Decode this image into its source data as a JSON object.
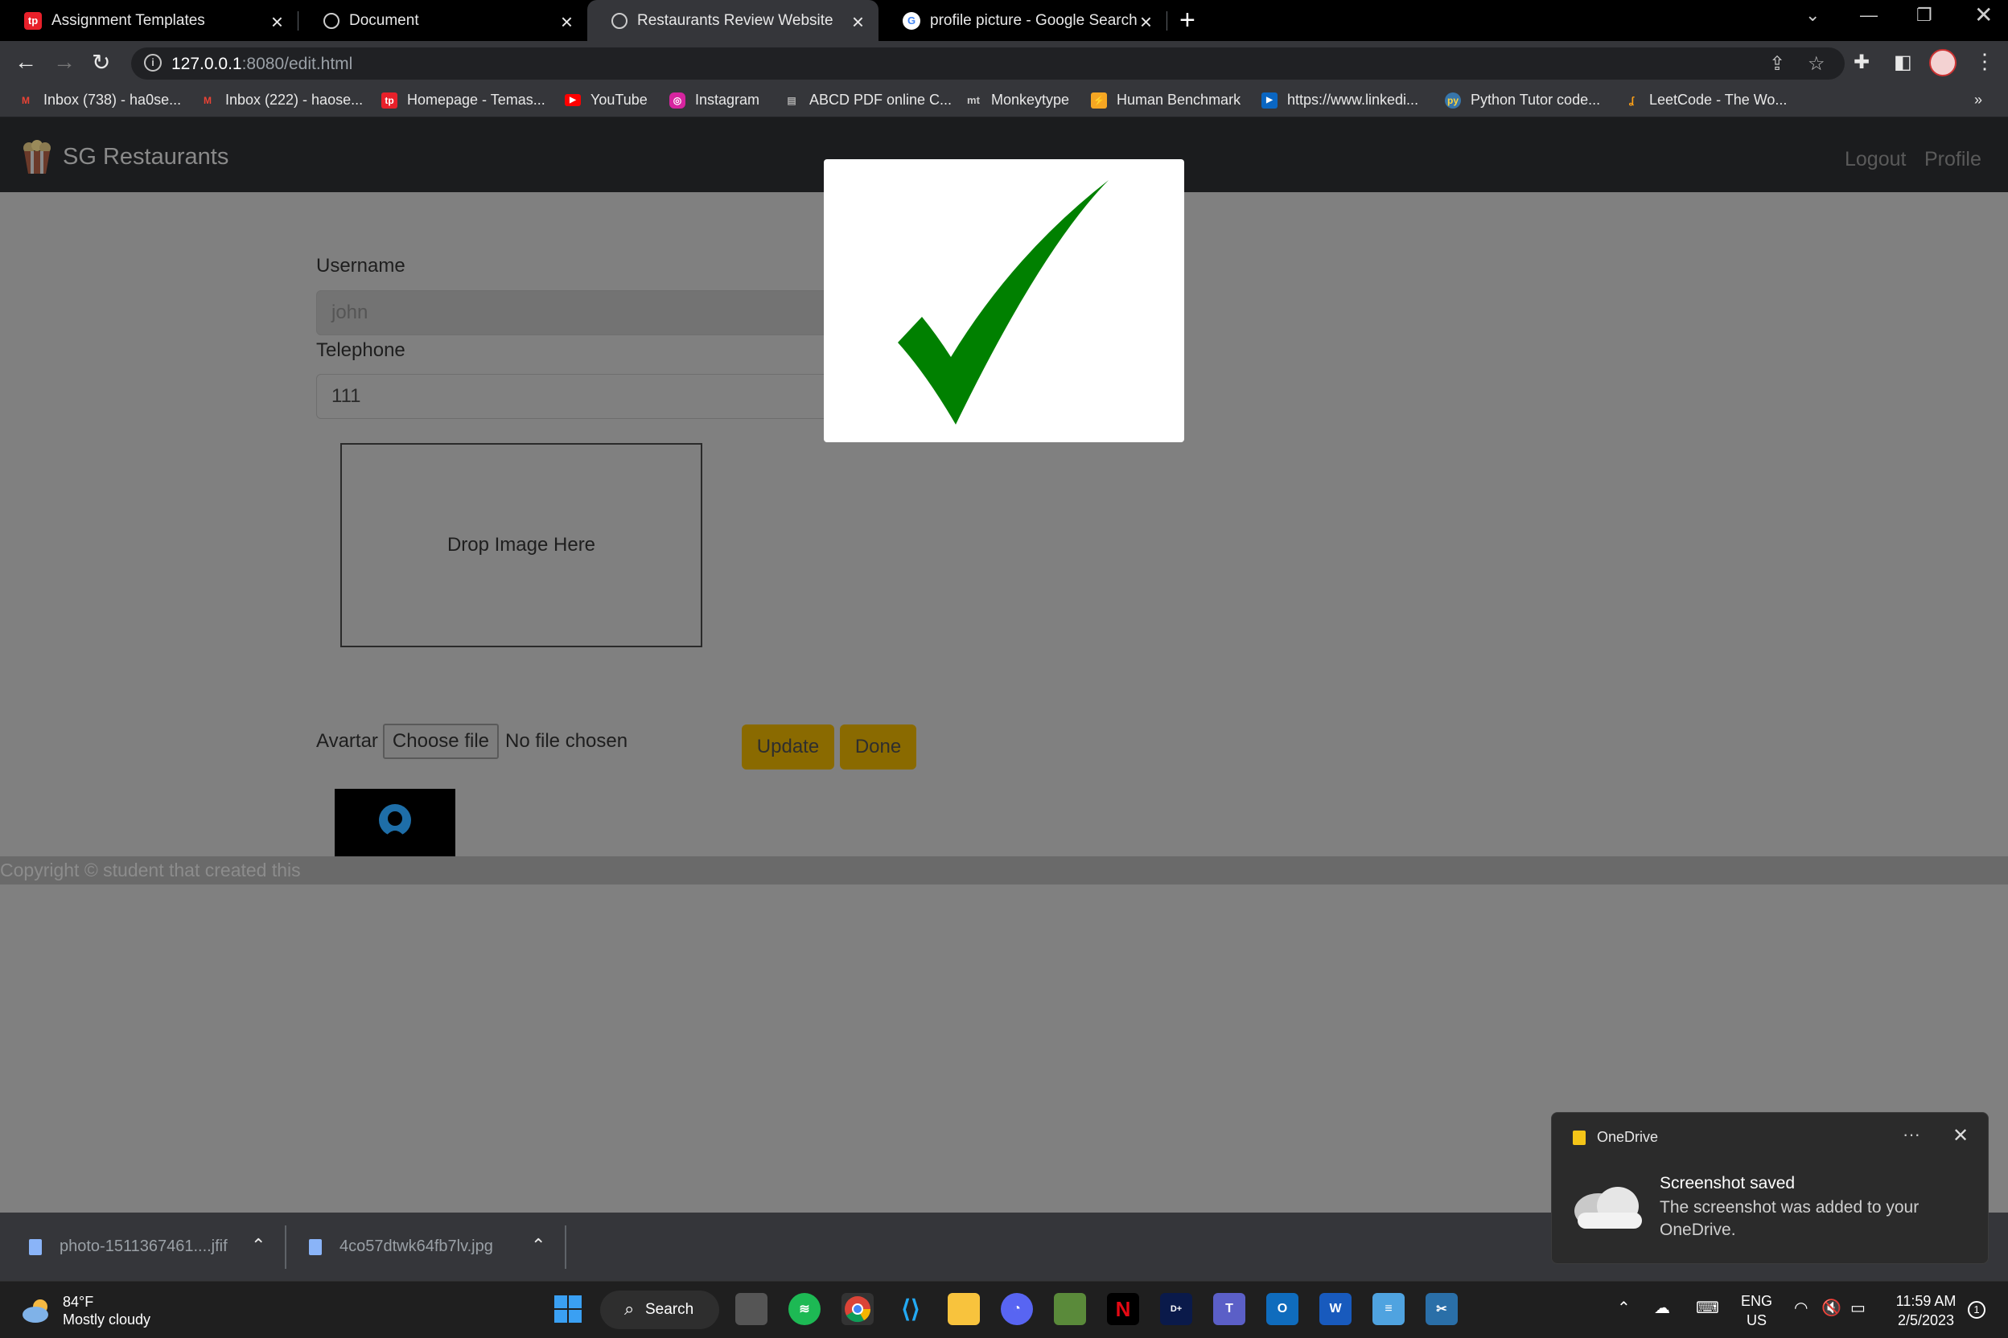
{
  "browser": {
    "tabs": [
      {
        "title": "Assignment Templates",
        "icon": "tp-icon"
      },
      {
        "title": "Document",
        "icon": "globe-icon"
      },
      {
        "title": "Restaurants Review Website",
        "icon": "globe-icon",
        "active": true
      },
      {
        "title": "profile picture - Google Search",
        "icon": "google-icon"
      }
    ],
    "new_tab": "+",
    "url_host": "127.0.0.1",
    "url_path": ":8080/edit.html",
    "bookmarks": [
      {
        "label": "Inbox (738) - ha0se...",
        "icon": "gmail-icon"
      },
      {
        "label": "Inbox (222) - haose...",
        "icon": "gmail-icon"
      },
      {
        "label": "Homepage - Temas...",
        "icon": "tp-icon"
      },
      {
        "label": "YouTube",
        "icon": "youtube-icon"
      },
      {
        "label": "Instagram",
        "icon": "instagram-icon"
      },
      {
        "label": "ABCD PDF online C...",
        "icon": "pdf-icon"
      },
      {
        "label": "Monkeytype",
        "icon": "monkeytype-icon"
      },
      {
        "label": "Human Benchmark",
        "icon": "lightning-icon"
      },
      {
        "label": "https://www.linkedi...",
        "icon": "linkedin-icon"
      },
      {
        "label": "Python Tutor code...",
        "icon": "python-icon"
      },
      {
        "label": "LeetCode - The Wo...",
        "icon": "leetcode-icon"
      }
    ],
    "bookmarks_more": "»"
  },
  "page": {
    "brand": "SG Restaurants",
    "nav": {
      "logout": "Logout",
      "profile": "Profile"
    },
    "form": {
      "username_label": "Username",
      "username_value": "john",
      "telephone_label": "Telephone",
      "telephone_value": "111",
      "drop_text": "Drop Image Here",
      "avatar_label": "Avartar",
      "choose_file": "Choose file",
      "file_status": "No file chosen",
      "update": "Update",
      "done": "Done"
    },
    "footer": "Copyright © student that created this"
  },
  "modal": {
    "icon": "checkmark-icon",
    "color": "#008000"
  },
  "downloads": [
    {
      "filename": "photo-1511367461....jfif"
    },
    {
      "filename": "4co57dtwk64fb7lv.jpg"
    }
  ],
  "toast": {
    "app": "OneDrive",
    "more": "···",
    "title": "Screenshot saved",
    "body": "The screenshot was added to your OneDrive."
  },
  "taskbar": {
    "temperature": "84°F",
    "weather": "Mostly cloudy",
    "search": "Search",
    "lang1": "ENG",
    "lang2": "US",
    "time": "11:59 AM",
    "date": "2/5/2023",
    "notification_count": "1"
  },
  "colors": {
    "accent_button": "#8a6a00",
    "checkmark": "#008000",
    "navbar": "#1b1c1e"
  }
}
